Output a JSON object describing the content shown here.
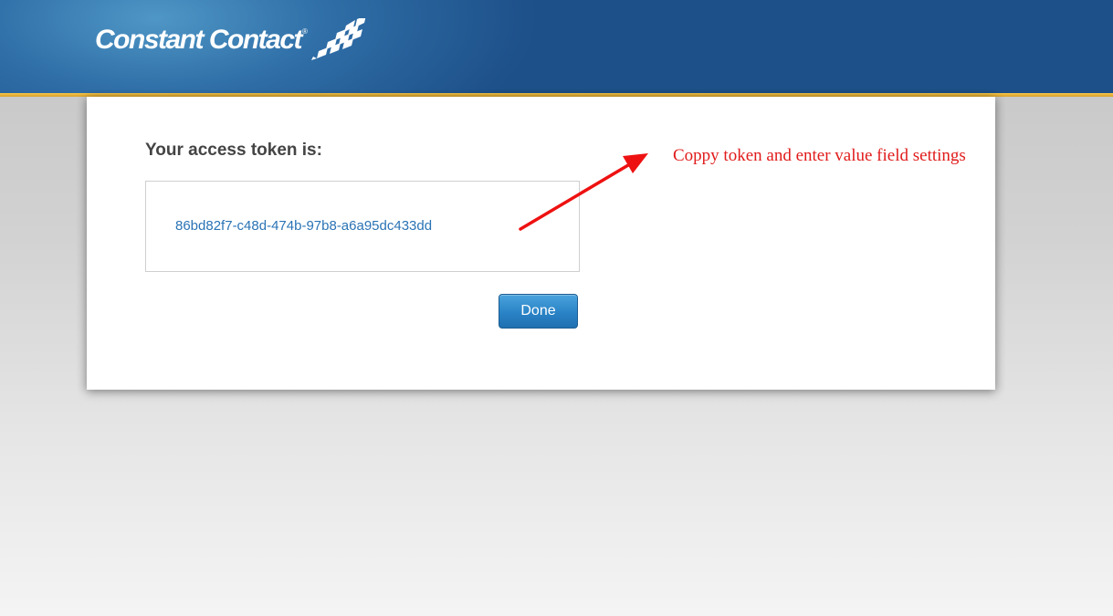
{
  "header": {
    "logo_text": "Constant Contact",
    "logo_reg": "®",
    "colors": {
      "header_bg": "#1d4f88",
      "accent_line": "#f6c74b"
    }
  },
  "panel": {
    "heading": "Your access token is:",
    "token": "86bd82f7-c48d-474b-97b8-a6a95dc433dd",
    "done_label": "Done"
  },
  "annotation": {
    "text": "Coppy token and enter value field settings",
    "color": "#e11b1b"
  },
  "icons": {
    "logo_mark": "checkered-flag-icon",
    "annotation_arrow": "arrow-icon"
  }
}
